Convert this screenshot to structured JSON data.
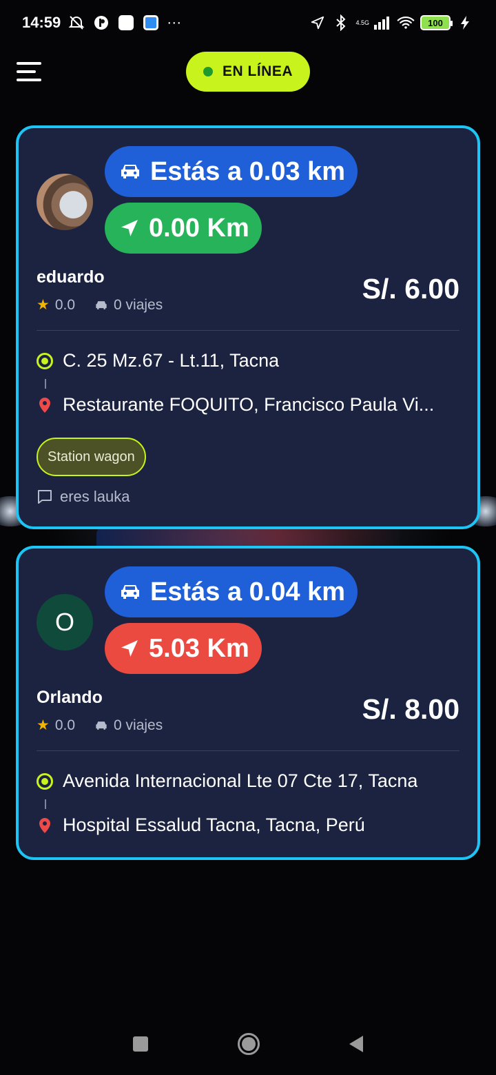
{
  "status_bar": {
    "time": "14:59",
    "network": "4.5G",
    "battery": "100",
    "more": "···"
  },
  "header": {
    "status_label": "EN LÍNEA",
    "status_color": "#c8f31d",
    "menu_icon": "hamburger-menu-icon"
  },
  "requests": [
    {
      "passenger_name": "eduardo",
      "avatar_letter": "",
      "distance_to_pickup": "Estás a 0.03 km",
      "trip_distance": "0.00 Km",
      "trip_distance_color": "#27b35a",
      "rating": "0.0",
      "trips": "0 viajes",
      "price": "S/. 6.00",
      "origin": "C. 25 Mz.67 - Lt.11, Tacna",
      "destination": "Restaurante FOQUITO, Francisco Paula Vi...",
      "vehicle_tag": "Station wagon",
      "note": "eres lauka"
    },
    {
      "passenger_name": "Orlando",
      "avatar_letter": "O",
      "distance_to_pickup": "Estás a 0.04 km",
      "trip_distance": "5.03 Km",
      "trip_distance_color": "#ea4a40",
      "rating": "0.0",
      "trips": "0 viajes",
      "price": "S/. 8.00",
      "origin": "Avenida Internacional Lte 07 Cte 17, Tacna",
      "destination": "Hospital Essalud Tacna, Tacna, Perú"
    }
  ],
  "colors": {
    "card_background": "#1c2340",
    "card_border": "#1ec4f4",
    "pickup_pill": "#1f5fd8"
  }
}
